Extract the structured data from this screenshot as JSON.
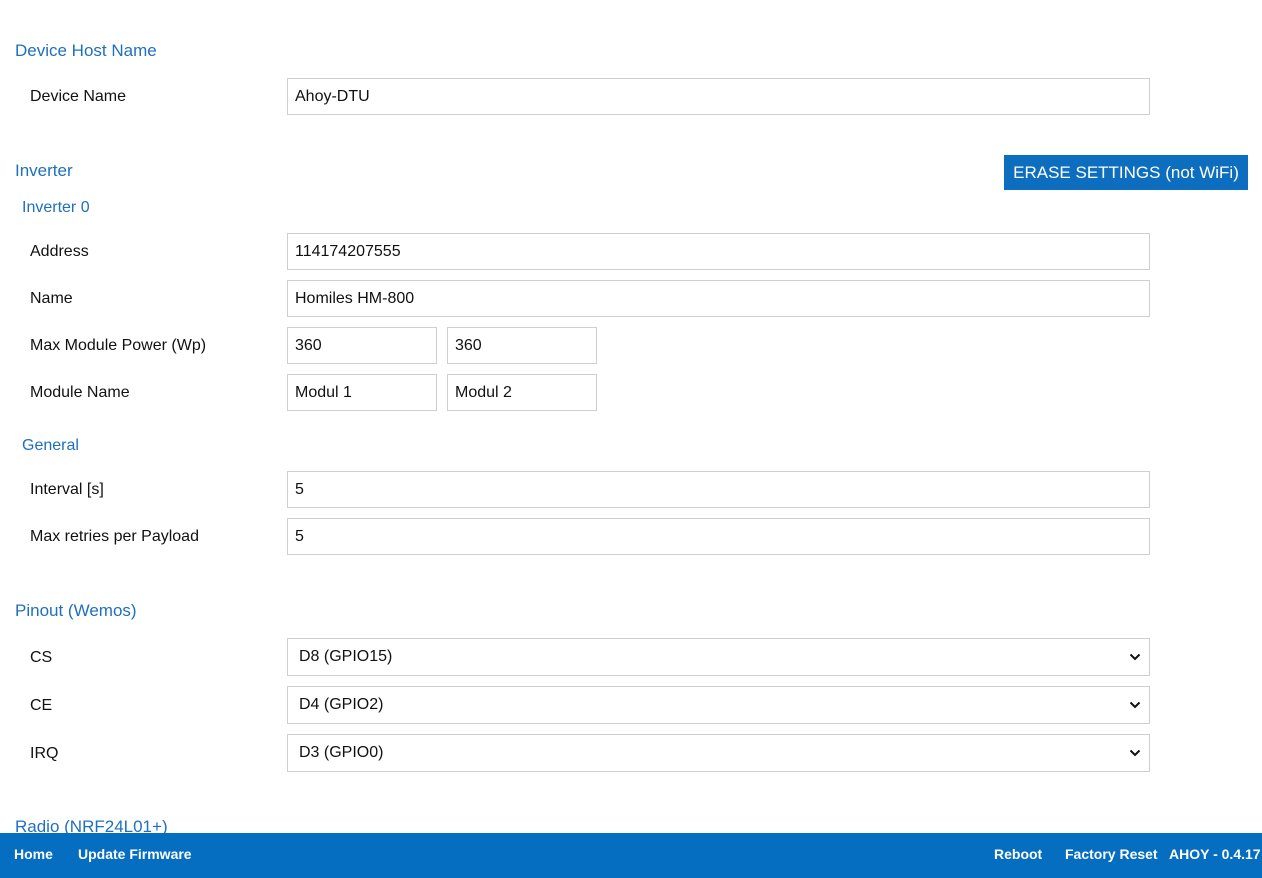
{
  "device_host": {
    "title": "Device Host Name",
    "device_name_label": "Device Name",
    "device_name_value": "Ahoy-DTU"
  },
  "inverter": {
    "title": "Inverter",
    "erase_button": "ERASE SETTINGS (not WiFi)",
    "inverter0": {
      "title": "Inverter 0",
      "address_label": "Address",
      "address_value": "114174207555",
      "name_label": "Name",
      "name_value": "Homiles HM-800",
      "max_power_label": "Max Module Power (Wp)",
      "max_power_values": [
        "360",
        "360"
      ],
      "module_name_label": "Module Name",
      "module_name_values": [
        "Modul 1",
        "Modul 2"
      ]
    },
    "general": {
      "title": "General",
      "interval_label": "Interval [s]",
      "interval_value": "5",
      "max_retries_label": "Max retries per Payload",
      "max_retries_value": "5"
    }
  },
  "pinout": {
    "title": "Pinout (Wemos)",
    "cs_label": "CS",
    "cs_value": "D8 (GPIO15)",
    "ce_label": "CE",
    "ce_value": "D4 (GPIO2)",
    "irq_label": "IRQ",
    "irq_value": "D3 (GPIO0)"
  },
  "radio": {
    "title": "Radio (NRF24L01+)"
  },
  "footer": {
    "home": "Home",
    "update_firmware": "Update Firmware",
    "reboot": "Reboot",
    "factory_reset": "Factory Reset",
    "version": "AHOY - 0.4.17"
  },
  "colors": {
    "accent": "#1f6fbf",
    "footer_bg": "#066ec0",
    "button_bg": "#0d6ebf"
  }
}
